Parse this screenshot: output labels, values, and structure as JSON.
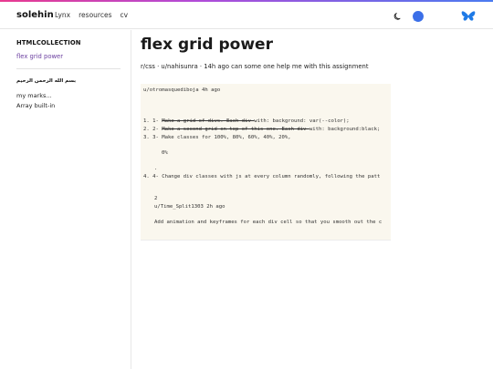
{
  "header": {
    "brand": "solehin",
    "nav": [
      "Lynx",
      "resources",
      "cv"
    ],
    "icons": {
      "theme": "moon-icon",
      "chat": "chat-bubble-icon",
      "social": "butterfly-icon"
    },
    "colors": {
      "accent_start": "#e83a8f",
      "accent_end": "#4a7bf0",
      "chat": "#3b6fe8",
      "butterfly": "#1f7ae6"
    }
  },
  "sidebar": {
    "title": "HTMLCOLLECTION",
    "active_link": "flex grid power",
    "arabic_line": "بسم الله الرحمن الرحيم",
    "items": [
      "my marks...",
      "Array built-in"
    ],
    "colors": {
      "active_link": "#6b3fa0"
    }
  },
  "main": {
    "title": "flex grid power",
    "meta": "r/css · u/nahisunra · 14h ago can some one help me with this assignment",
    "code": {
      "user_line": "u/otromasquediboja 4h ago",
      "line1_prefix": "1. 1- ",
      "line1_struck": "Make a grid of divs. Each div ",
      "line1_rest": "with: background: var(--color);",
      "line2_prefix": "2. 2- ",
      "line2_struck": "Make a second grid on top of this one. Each div ",
      "line2_rest": "with: background:black;",
      "line3": "3. 3- Make classes for 100%, 80%, 60%, 40%, 20%,",
      "pct": "0%",
      "dot": ".",
      "line4": "4. 4- Change div classes with js at every column randomly, following the patt",
      "num": "2",
      "reply_user": "u/Time_Split1303 2h ago",
      "reply_text": "Add animation and keyframes for each div cell so that you smooth out the c"
    }
  }
}
